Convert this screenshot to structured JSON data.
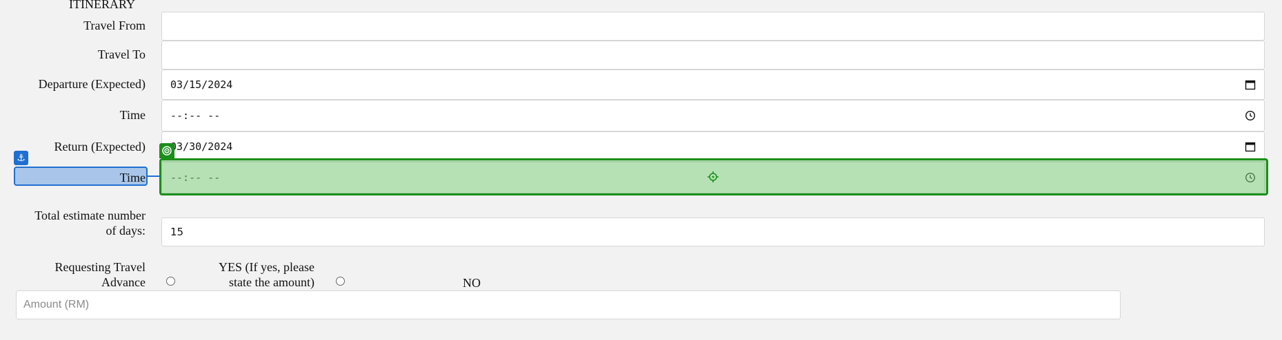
{
  "section": {
    "title": "ITINERARY"
  },
  "fields": {
    "travel_from": {
      "label": "Travel From",
      "value": ""
    },
    "travel_to": {
      "label": "Travel To",
      "value": ""
    },
    "departure": {
      "label": "Departure (Expected)",
      "value": "03/15/2024",
      "icon": "calendar-icon"
    },
    "departure_time": {
      "label": "Time",
      "value": "--:-- --",
      "icon": "clock-icon"
    },
    "return": {
      "label": "Return (Expected)",
      "value": "03/30/2024",
      "icon": "calendar-icon"
    },
    "return_time": {
      "label": "Time",
      "value": "--:-- --",
      "icon": "clock-icon"
    },
    "total_days": {
      "label_line1": "Total estimate number",
      "label_line2": "of days:",
      "value": "15"
    }
  },
  "travel_advance": {
    "label_line1": "Requesting Travel",
    "label_line2": "Advance",
    "yes_line1": "YES (If yes, please",
    "yes_line2": "state the amount)",
    "no": "NO"
  },
  "amount": {
    "placeholder": "Amount (RM)"
  },
  "overlay": {
    "anchor_icon": "anchor-icon",
    "target_icon": "target-icon",
    "accent_blue": "#1f6fd1",
    "accent_green": "#1a8f1a"
  }
}
